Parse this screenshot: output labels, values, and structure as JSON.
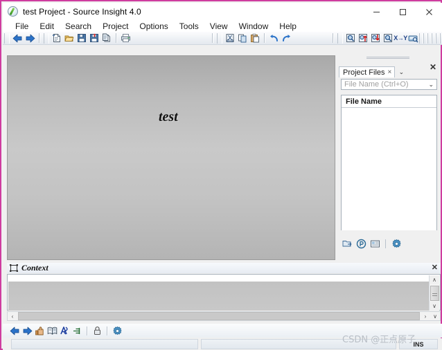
{
  "window": {
    "title": "test Project - Source Insight 4.0",
    "app_icon": "source-insight-icon",
    "minimize_label": "—",
    "maximize_label": "❑",
    "close_label": "✕"
  },
  "menubar": {
    "items": [
      {
        "label": "File"
      },
      {
        "label": "Edit"
      },
      {
        "label": "Search"
      },
      {
        "label": "Project"
      },
      {
        "label": "Options"
      },
      {
        "label": "Tools"
      },
      {
        "label": "View"
      },
      {
        "label": "Window"
      },
      {
        "label": "Help"
      }
    ]
  },
  "toolbar": {
    "groups": [
      {
        "buttons": [
          {
            "name": "back-icon",
            "title": "Back"
          },
          {
            "name": "forward-icon",
            "title": "Forward"
          }
        ]
      },
      {
        "buttons": [
          {
            "name": "new-file-icon",
            "title": "New File"
          },
          {
            "name": "open-file-icon",
            "title": "Open File"
          },
          {
            "name": "save-icon",
            "title": "Save"
          },
          {
            "name": "save-all-icon",
            "title": "Save All"
          },
          {
            "name": "close-file-icon",
            "title": "Close File"
          }
        ]
      },
      {
        "buttons": [
          {
            "name": "print-icon",
            "title": "Print"
          }
        ]
      },
      {
        "buttons": [
          {
            "name": "cut-icon",
            "title": "Cut"
          },
          {
            "name": "copy-icon",
            "title": "Copy"
          },
          {
            "name": "paste-icon",
            "title": "Paste"
          }
        ]
      },
      {
        "buttons": [
          {
            "name": "undo-icon",
            "title": "Undo"
          },
          {
            "name": "redo-icon",
            "title": "Redo"
          }
        ]
      },
      {
        "buttons": [
          {
            "name": "search-icon",
            "title": "Search"
          },
          {
            "name": "search-backward-icon",
            "title": "Search Backward"
          },
          {
            "name": "search-forward-icon",
            "title": "Search Forward"
          },
          {
            "name": "lookup-reference-icon",
            "title": "Lookup Reference"
          },
          {
            "name": "replace-icon",
            "title": "Replace",
            "text": "X→Y"
          },
          {
            "name": "search-files-icon",
            "title": "Search Files"
          }
        ]
      }
    ]
  },
  "editor": {
    "document_text": "test"
  },
  "project_files_panel": {
    "tab_label": "Project Files",
    "tab_close": "×",
    "tab_menu_caret": "⌄",
    "panel_close": "✕",
    "combo_placeholder": "File Name (Ctrl+O)",
    "combo_value": "",
    "combo_caret": "⌄",
    "list_header": "File Name",
    "list_rows": [],
    "footer_buttons": [
      {
        "name": "open-project-icon",
        "title": "Open Project"
      },
      {
        "name": "project-properties-icon",
        "title": "Project Properties"
      },
      {
        "name": "project-report-icon",
        "title": "Project Report"
      },
      {
        "name": "project-settings-gear-icon",
        "title": "Settings"
      }
    ]
  },
  "context_panel": {
    "title": "Context",
    "icon": "context-window-icon",
    "close": "✕",
    "content": "",
    "vscroll": {
      "up": "∧",
      "down": "∨"
    },
    "hscroll": {
      "left": "‹",
      "right": "›",
      "extra": "∨"
    }
  },
  "bottom_toolbar": {
    "buttons": [
      {
        "name": "back-icon",
        "title": "Back"
      },
      {
        "name": "forward-icon",
        "title": "Forward"
      },
      {
        "name": "jump-to-definition-icon",
        "title": "Jump To Definition"
      },
      {
        "name": "browse-project-symbols-icon",
        "title": "Browse Project Symbols"
      },
      {
        "name": "relation-window-icon",
        "title": "Relation Window"
      },
      {
        "name": "smart-rename-icon",
        "title": "Smart Rename"
      },
      {
        "name": "lock-icon",
        "title": "Lock Context"
      },
      {
        "name": "context-options-gear-icon",
        "title": "Options"
      }
    ]
  },
  "statusbar": {
    "cell_1": "",
    "cell_2": "",
    "insert_mode": "INS"
  },
  "watermark": {
    "text": "CSDN @正点原子"
  },
  "colors": {
    "window_border": "#cf3c9f",
    "chrome": "#f0f0f0",
    "editor_bg": "#c3c3c3",
    "accent_blue": "#1c6fc4"
  }
}
